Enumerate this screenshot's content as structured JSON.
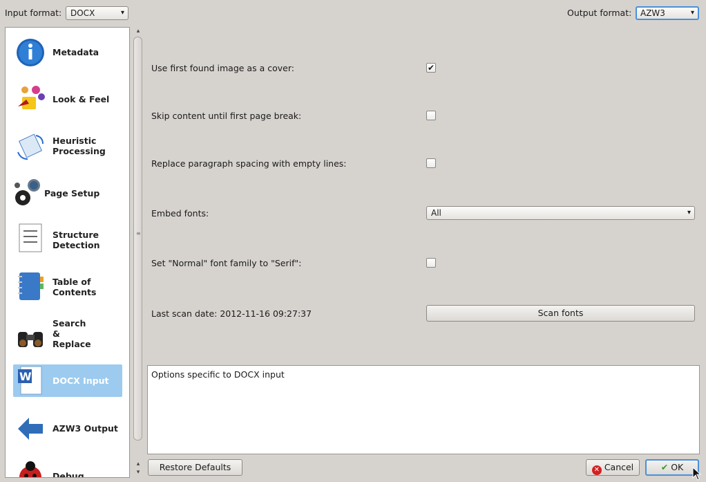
{
  "header": {
    "input_label": "Input format:",
    "input_value": "DOCX",
    "output_label": "Output format:",
    "output_value": "AZW3"
  },
  "sidebar": {
    "items": [
      {
        "label": "Metadata",
        "icon": "info-icon"
      },
      {
        "label": "Look & Feel",
        "icon": "paint-icon"
      },
      {
        "label": "Heuristic Processing",
        "icon": "heuristic-icon"
      },
      {
        "label": "Page Setup",
        "icon": "gears-icon"
      },
      {
        "label": "Structure Detection",
        "icon": "document-icon"
      },
      {
        "label": "Table of Contents",
        "icon": "notebook-icon"
      },
      {
        "label": "Search & Replace",
        "icon": "binoculars-icon"
      },
      {
        "label": "DOCX Input",
        "icon": "word-document-icon",
        "selected": true
      },
      {
        "label": "AZW3 Output",
        "icon": "arrow-left-icon"
      },
      {
        "label": "Debug",
        "icon": "ladybug-icon"
      }
    ]
  },
  "options": {
    "cover_label": "Use first found image as a cover:",
    "cover_checked": true,
    "skip_label": "Skip content until first page break:",
    "skip_checked": false,
    "replace_label": "Replace paragraph spacing with empty lines:",
    "replace_checked": false,
    "embed_label": "Embed fonts:",
    "embed_value": "All",
    "serif_label": "Set \"Normal\" font family to \"Serif\":",
    "serif_checked": false,
    "scan_date_label": "Last scan date: 2012-11-16 09:27:37",
    "scan_button": "Scan fonts"
  },
  "description": "Options specific to DOCX input",
  "footer": {
    "restore": "Restore Defaults",
    "cancel": "Cancel",
    "ok": "OK"
  }
}
